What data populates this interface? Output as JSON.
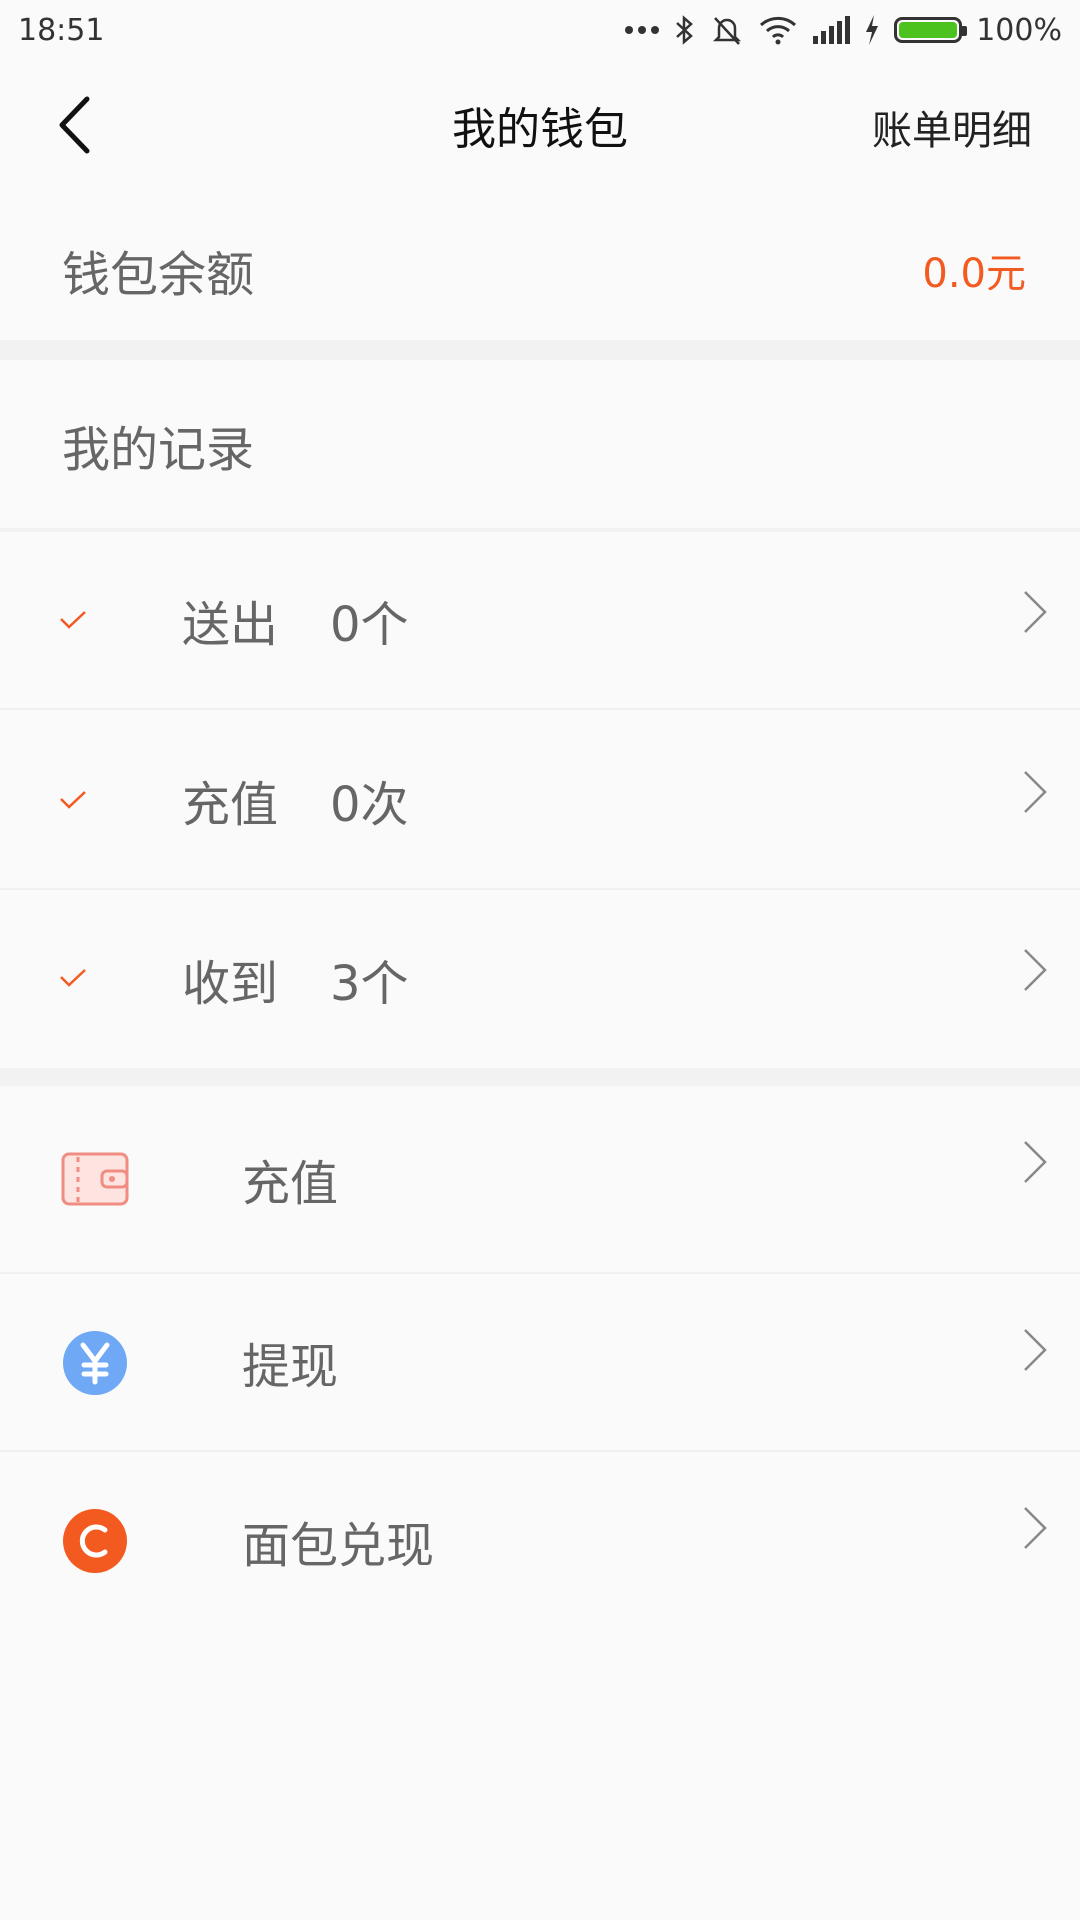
{
  "status_bar": {
    "time": "18:51",
    "battery": "100%"
  },
  "header": {
    "title": "我的钱包",
    "right_label": "账单明细"
  },
  "balance": {
    "label": "钱包余额",
    "value": "0.0元"
  },
  "records": {
    "title": "我的记录",
    "items": [
      {
        "label": "送出",
        "count": "0个"
      },
      {
        "label": "充值",
        "count": "0次"
      },
      {
        "label": "收到",
        "count": "3个"
      }
    ]
  },
  "actions": [
    {
      "label": "充值",
      "icon": "wallet-icon"
    },
    {
      "label": "提现",
      "icon": "yuan-icon"
    },
    {
      "label": "面包兑现",
      "icon": "coin-c-icon"
    }
  ],
  "colors": {
    "accent": "#f35a20",
    "blue": "#6fa8f5",
    "wallet": "#f08c82"
  }
}
